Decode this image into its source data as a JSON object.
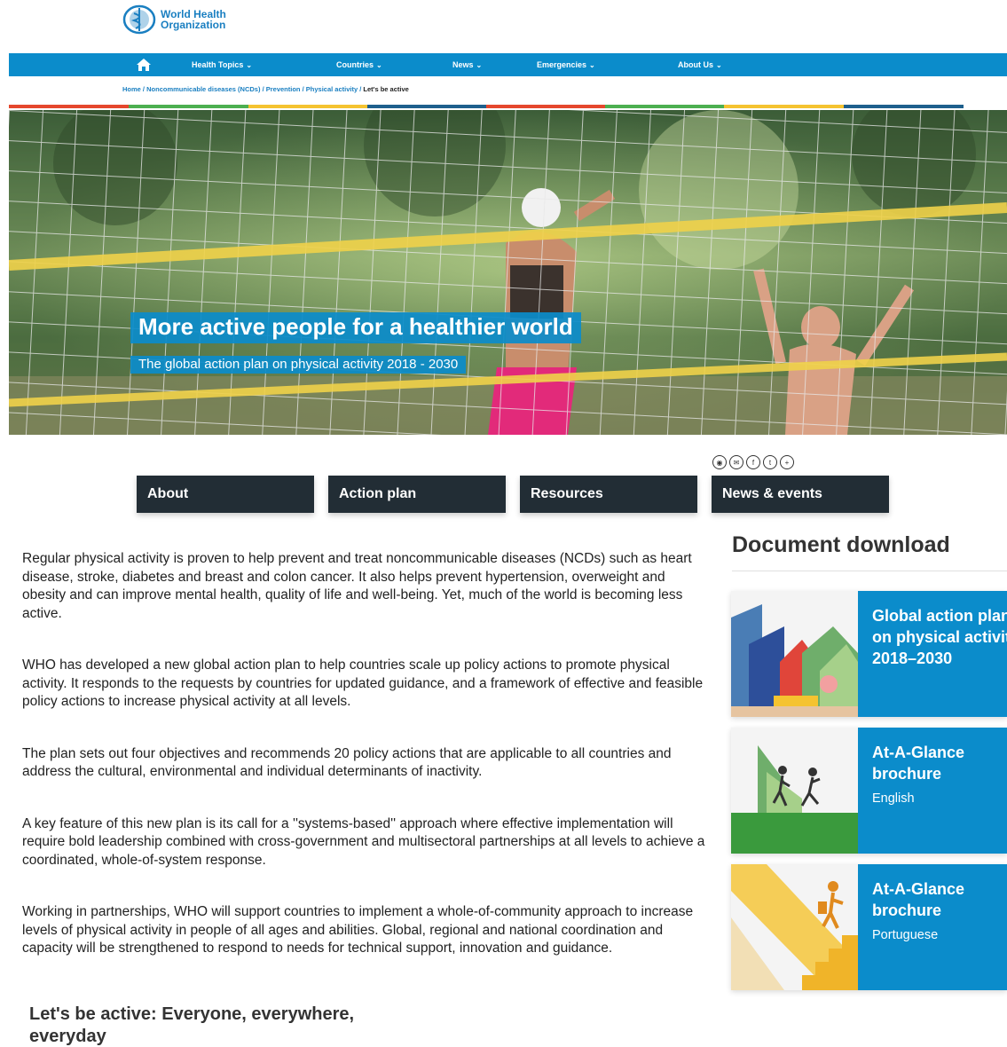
{
  "header": {
    "logo_line1": "World Health",
    "logo_line2": "Organization"
  },
  "nav": {
    "items": [
      {
        "label": "Health Topics"
      },
      {
        "label": "Countries"
      },
      {
        "label": "News"
      },
      {
        "label": "Emergencies"
      },
      {
        "label": "About Us"
      }
    ]
  },
  "breadcrumb": {
    "items": [
      "Home",
      "Noncommunicable diseases (NCDs)",
      "Prevention",
      "Physical activity"
    ],
    "current": "Let's be active"
  },
  "colors": {
    "brand_blue": "#0b8ccb",
    "dark_tab": "#222d35",
    "strip": [
      "#e5472d",
      "#4caf50",
      "#f5c330",
      "#1e5f8c",
      "#e5472d",
      "#4caf50",
      "#f5c330",
      "#1e5f8c"
    ]
  },
  "hero": {
    "title": "More active people for a healthier world",
    "subtitle": "The global action plan on physical activity 2018 - 2030"
  },
  "share": {
    "icons": [
      "reddit-icon",
      "email-icon",
      "facebook-icon",
      "twitter-icon",
      "plus-icon"
    ],
    "glyphs": [
      "◉",
      "✉",
      "f",
      "t",
      "+"
    ]
  },
  "tabs": [
    {
      "label": "About"
    },
    {
      "label": "Action plan"
    },
    {
      "label": "Resources"
    },
    {
      "label": "News & events"
    }
  ],
  "main": {
    "paragraphs": [
      "Regular physical activity is proven to help prevent and treat noncommunicable diseases (NCDs) such as heart disease, stroke, diabetes and breast and colon cancer. It also helps prevent hypertension, overweight and obesity and can improve mental health, quality of life and well-being. Yet, much of the world is becoming less active.",
      "WHO has developed a new global action plan to help countries scale up policy actions to promote physical activity. It responds to the requests by countries for updated guidance, and a framework of effective and feasible policy actions to increase physical activity at all levels.",
      "The plan sets out four objectives and recommends 20 policy actions that are applicable to all countries and address the cultural, environmental and individual determinants of inactivity.",
      "A key feature of this new plan is its call for a ''systems-based'' approach where effective implementation will require bold leadership combined with cross-government and multisectoral partnerships at all levels to achieve a coordinated, whole-of-system response.",
      "Working in partnerships, WHO will support countries to implement a whole-of-community approach to increase levels of physical activity in people of all ages and abilities. Global, regional and national coordination and capacity will be strengthened to respond to needs for technical support, innovation and guidance."
    ],
    "subheading": "Let's be active: Everyone, everywhere, everyday"
  },
  "side": {
    "title": "Document download",
    "cards": [
      {
        "title_line1": "Global action plan",
        "title_line2": "on physical activity",
        "title_line3": "2018–2030",
        "sub": ""
      },
      {
        "title_line1": "At-A-Glance",
        "title_line2": "brochure",
        "title_line3": "",
        "sub": "English"
      },
      {
        "title_line1": "At-A-Glance",
        "title_line2": "brochure",
        "title_line3": "",
        "sub": "Portuguese"
      }
    ]
  }
}
